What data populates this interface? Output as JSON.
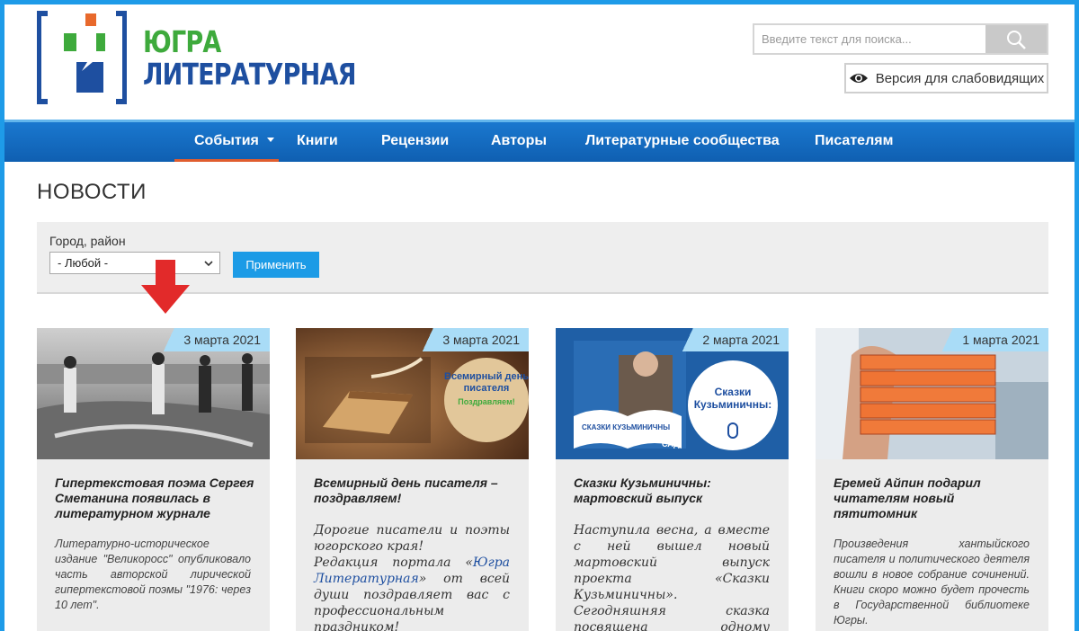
{
  "brand": {
    "line1": "ЮГРА",
    "line2": "ЛИТЕРАТУРНАЯ",
    "colors": {
      "green": "#3eaa3c",
      "blue": "#1e4fa0",
      "orange": "#e8692c"
    }
  },
  "search": {
    "placeholder": "Введите текст для поиска...",
    "icon": "search-icon"
  },
  "accessibility": {
    "label": "Версия для слабовидящих",
    "icon": "eye-icon"
  },
  "nav": {
    "items": [
      {
        "label": "События",
        "active": true,
        "has_dropdown": true
      },
      {
        "label": "Книги"
      },
      {
        "label": "Рецензии"
      },
      {
        "label": "Авторы"
      },
      {
        "label": "Литературные сообщества"
      },
      {
        "label": "Писателям"
      }
    ]
  },
  "page": {
    "title": "НОВОСТИ"
  },
  "filter": {
    "label": "Город, район",
    "selected": "- Любой -",
    "apply": "Применить"
  },
  "cards": [
    {
      "date": "3 марта 2021",
      "title": "Гипертекстовая поэма Сергея Сметанина появилась в литературном журнале",
      "body": "Литературно-историческое издание \"Великоросс\" опубликовало часть авторской лирической гипертекстовой поэмы \"1976: через 10 лет\"."
    },
    {
      "date": "3 марта 2021",
      "title": "Всемирный день писателя – поздравляем!",
      "body_parts": [
        "Дорогие писатели и поэты югорского края!",
        "Редакция портала «",
        "Югра Литературная",
        "» от всей души поздравляет вас с профессиональным праздником!"
      ],
      "badge": {
        "line1": "Всемирный день",
        "line2": "писателя",
        "line3": "Поздравляем!"
      }
    },
    {
      "date": "2 марта 2021",
      "title": "Сказки Кузьминичны: мартовский выпуск",
      "body": "Наступила весна, а вместе с ней вышел новый мартовский выпуск проекта «Сказки Кузьминичны». Сегодняшняя сказка посвящена одному священному образу, которого обские угры чтут с давних",
      "badge": {
        "line1": "Сказки",
        "line2": "Кузьминичны:",
        "book_text": "СКАЗКИ КУЗЬМИНИЧНЫ",
        "corner": "САД"
      }
    },
    {
      "date": "1 марта 2021",
      "title": "Еремей Айпин подарил читателям новый пятитомник",
      "body": "Произведения хантыйского писателя и политического деятеля вошли в новое собрание сочинений. Книги скоро можно будет прочесть в Государственной библиотеке Югры."
    }
  ]
}
